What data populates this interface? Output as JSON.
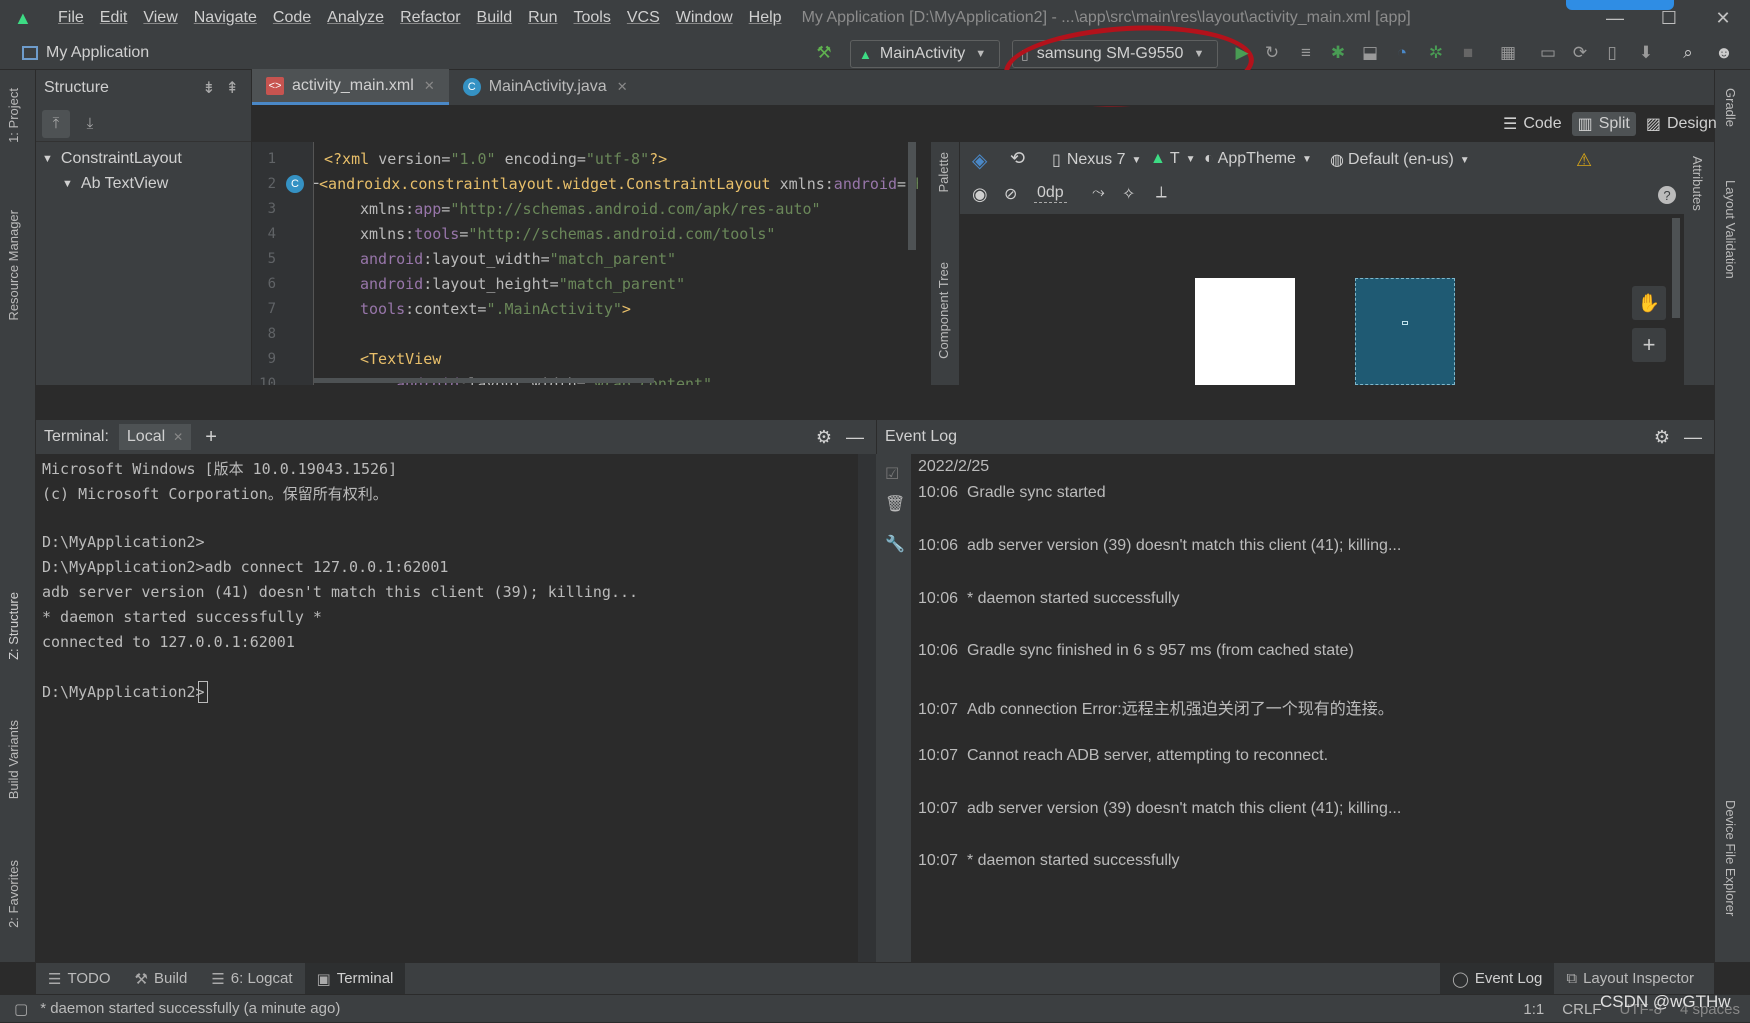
{
  "menubar": {
    "items": [
      "File",
      "Edit",
      "View",
      "Navigate",
      "Code",
      "Analyze",
      "Refactor",
      "Build",
      "Run",
      "Tools",
      "VCS",
      "Window",
      "Help"
    ],
    "title": "My Application [D:\\MyApplication2] - ...\\app\\src\\main\\res\\layout\\activity_main.xml [app]"
  },
  "navbar": {
    "project_name": "My Application",
    "run_config": "MainActivity",
    "device": "samsung SM-G9550"
  },
  "structure": {
    "title": "Structure",
    "tree": [
      {
        "label": "ConstraintLayout",
        "depth": 0
      },
      {
        "label": "Ab TextView",
        "depth": 1
      }
    ]
  },
  "editor": {
    "tabs": [
      {
        "label": "activity_main.xml",
        "active": true
      },
      {
        "label": "MainActivity.java",
        "active": false
      }
    ],
    "view_modes": [
      "Code",
      "Split",
      "Design"
    ],
    "active_view_mode": "Split",
    "line_numbers": [
      "1",
      "2",
      "3",
      "4",
      "5",
      "6",
      "7",
      "8",
      "9",
      "10"
    ]
  },
  "design_toolbar": {
    "device": "Nexus 7",
    "api": "T",
    "theme": "AppTheme",
    "locale": "Default (en-us)",
    "margin": "0dp"
  },
  "side_tabs": {
    "left": [
      "1: Project",
      "Resource Manager",
      "Z: Structure",
      "Build Variants",
      "2: Favorites"
    ],
    "right": [
      "Gradle",
      "Layout Validation",
      "Device File Explorer"
    ],
    "palette": [
      "Palette",
      "Component Tree",
      "Attributes"
    ]
  },
  "terminal": {
    "label": "Terminal:",
    "tab": "Local",
    "lines": [
      "Microsoft Windows [版本 10.0.19043.1526]",
      "(c) Microsoft Corporation。保留所有权利。",
      "",
      "D:\\MyApplication2>",
      "D:\\MyApplication2>adb connect 127.0.0.1:62001",
      "adb server version (41) doesn't match this client (39); killing...",
      "* daemon started successfully *",
      "connected to 127.0.0.1:62001",
      "",
      "D:\\MyApplication2>"
    ]
  },
  "event_log": {
    "title": "Event Log",
    "date": "2022/2/25",
    "entries": [
      {
        "time": "10:06",
        "text": "Gradle sync started"
      },
      {
        "time": "10:06",
        "text": "adb server version (39) doesn't match this client (41); killing..."
      },
      {
        "time": "10:06",
        "text": "* daemon started successfully"
      },
      {
        "time": "10:06",
        "text": "Gradle sync finished in 6 s 957 ms (from cached state)"
      },
      {
        "time": "10:07",
        "text": "Adb connection Error:远程主机强迫关闭了一个现有的连接。"
      },
      {
        "time": "10:07",
        "text": "Cannot reach ADB server, attempting to reconnect."
      },
      {
        "time": "10:07",
        "text": "adb server version (39) doesn't match this client (41); killing..."
      },
      {
        "time": "10:07",
        "text": "* daemon started successfully"
      }
    ]
  },
  "bottom_tabs": [
    {
      "label": "TODO",
      "icon": "list-icon"
    },
    {
      "label": "Build",
      "icon": "hammer-icon"
    },
    {
      "label": "6: Logcat",
      "icon": "logcat-icon"
    },
    {
      "label": "Terminal",
      "icon": "terminal-icon",
      "active": true
    }
  ],
  "bottom_right_tabs": [
    {
      "label": "Event Log"
    },
    {
      "label": "Layout Inspector"
    }
  ],
  "statusbar": {
    "message": "* daemon started successfully (a minute ago)",
    "position": "1:1",
    "line_sep": "CRLF",
    "encoding": "UTF-8",
    "indent": "4 spaces",
    "watermark": "CSDN @wGTHw"
  },
  "colors": {
    "accent": "#4a88c7",
    "android_green": "#3ddc84",
    "highlight_red": "#b3121b",
    "blueprint": "#1f5a73"
  }
}
